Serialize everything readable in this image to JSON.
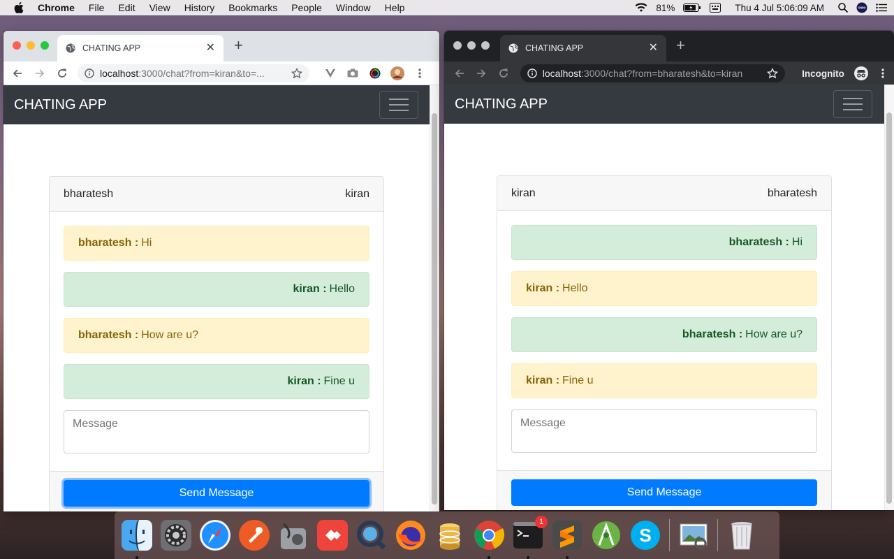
{
  "menubar": {
    "app_name": "Chrome",
    "items": [
      "File",
      "Edit",
      "View",
      "History",
      "Bookmarks",
      "People",
      "Window",
      "Help"
    ],
    "battery": "81%",
    "datetime": "Thu 4 Jul  5:06:09 AM"
  },
  "left_window": {
    "tab_title": "CHATING APP",
    "url_host": "localhost",
    "url_rest": ":3000/chat?from=kiran&to=...",
    "app_title": "CHATING APP",
    "header_left": "bharatesh",
    "header_right": "kiran",
    "messages": [
      {
        "sender": "bharatesh :",
        "text": "Hi",
        "style": "yellow"
      },
      {
        "sender": "kiran :",
        "text": "Hello",
        "style": "green"
      },
      {
        "sender": "bharatesh :",
        "text": "How are u?",
        "style": "yellow"
      },
      {
        "sender": "kiran :",
        "text": "Fine u",
        "style": "green"
      }
    ],
    "input_placeholder": "Message",
    "send_label": "Send Message"
  },
  "right_window": {
    "tab_title": "CHATING APP",
    "url_host": "localhost",
    "url_rest": ":3000/chat?from=bharatesh&to=kiran",
    "incognito_label": "Incognito",
    "app_title": "CHATING APP",
    "header_left": "kiran",
    "header_right": "bharatesh",
    "messages": [
      {
        "sender": "bharatesh :",
        "text": "Hi",
        "style": "green"
      },
      {
        "sender": "kiran :",
        "text": "Hello",
        "style": "yellow"
      },
      {
        "sender": "bharatesh :",
        "text": "How are u?",
        "style": "green"
      },
      {
        "sender": "kiran :",
        "text": "Fine u",
        "style": "yellow"
      }
    ],
    "input_placeholder": "Message",
    "send_label": "Send Message"
  },
  "dock": {
    "terminal_badge": "1",
    "apps": [
      "finder-icon",
      "system-preferences-icon",
      "safari-icon",
      "postman-icon",
      "disk-utility-icon",
      "anydesk-icon",
      "quicktime-icon",
      "firefox-icon",
      "sequel-pro-icon",
      "chrome-icon",
      "terminal-icon",
      "sublime-text-icon",
      "android-studio-icon",
      "skype-icon",
      "preview-icon",
      "trash-icon"
    ]
  },
  "colors": {
    "navbar": "#343a40",
    "primary": "#007bff",
    "alert_yellow": "#fff3cd",
    "alert_green": "#d4edda"
  }
}
